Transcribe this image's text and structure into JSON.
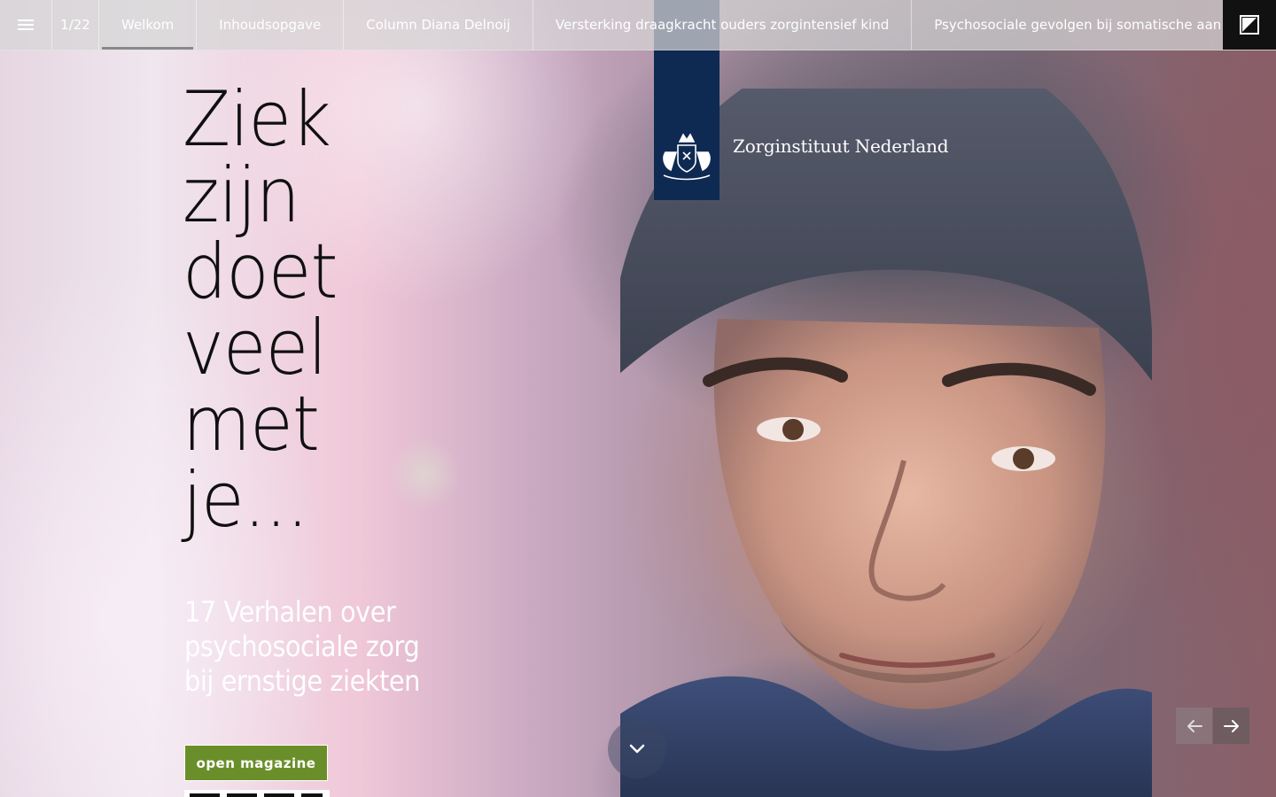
{
  "topbar": {
    "menu_icon": "hamburger-menu-icon",
    "page_counter": "1/22",
    "tabs": [
      {
        "label": "Welkom",
        "active": true
      },
      {
        "label": "Inhoudsopgave",
        "active": false
      },
      {
        "label": "Column Diana Delnoij",
        "active": false
      },
      {
        "label": "Versterking draagkracht ouders zorgintensief kind",
        "active": false
      },
      {
        "label": "Psychosociale gevolgen bij somatische aan",
        "active": false
      }
    ],
    "brand_icon": "brand-corner-icon"
  },
  "logo": {
    "text": "Zorginstituut Nederland",
    "emblem_icon": "royal-coat-of-arms-icon",
    "band_color": "#0f2a52"
  },
  "hero": {
    "headline_lines": [
      "Ziek",
      "zijn",
      "doet",
      "veel",
      "met",
      "je..."
    ],
    "subtitle_lines": [
      "17 Verhalen over",
      "psychosociale zorg",
      "bij ernstige ziekten"
    ],
    "cta_label": "open magazine",
    "cta_color": "#6a8f2a"
  },
  "controls": {
    "scroll_down_icon": "chevron-down-icon",
    "prev_icon": "arrow-left-icon",
    "next_icon": "arrow-right-icon"
  }
}
